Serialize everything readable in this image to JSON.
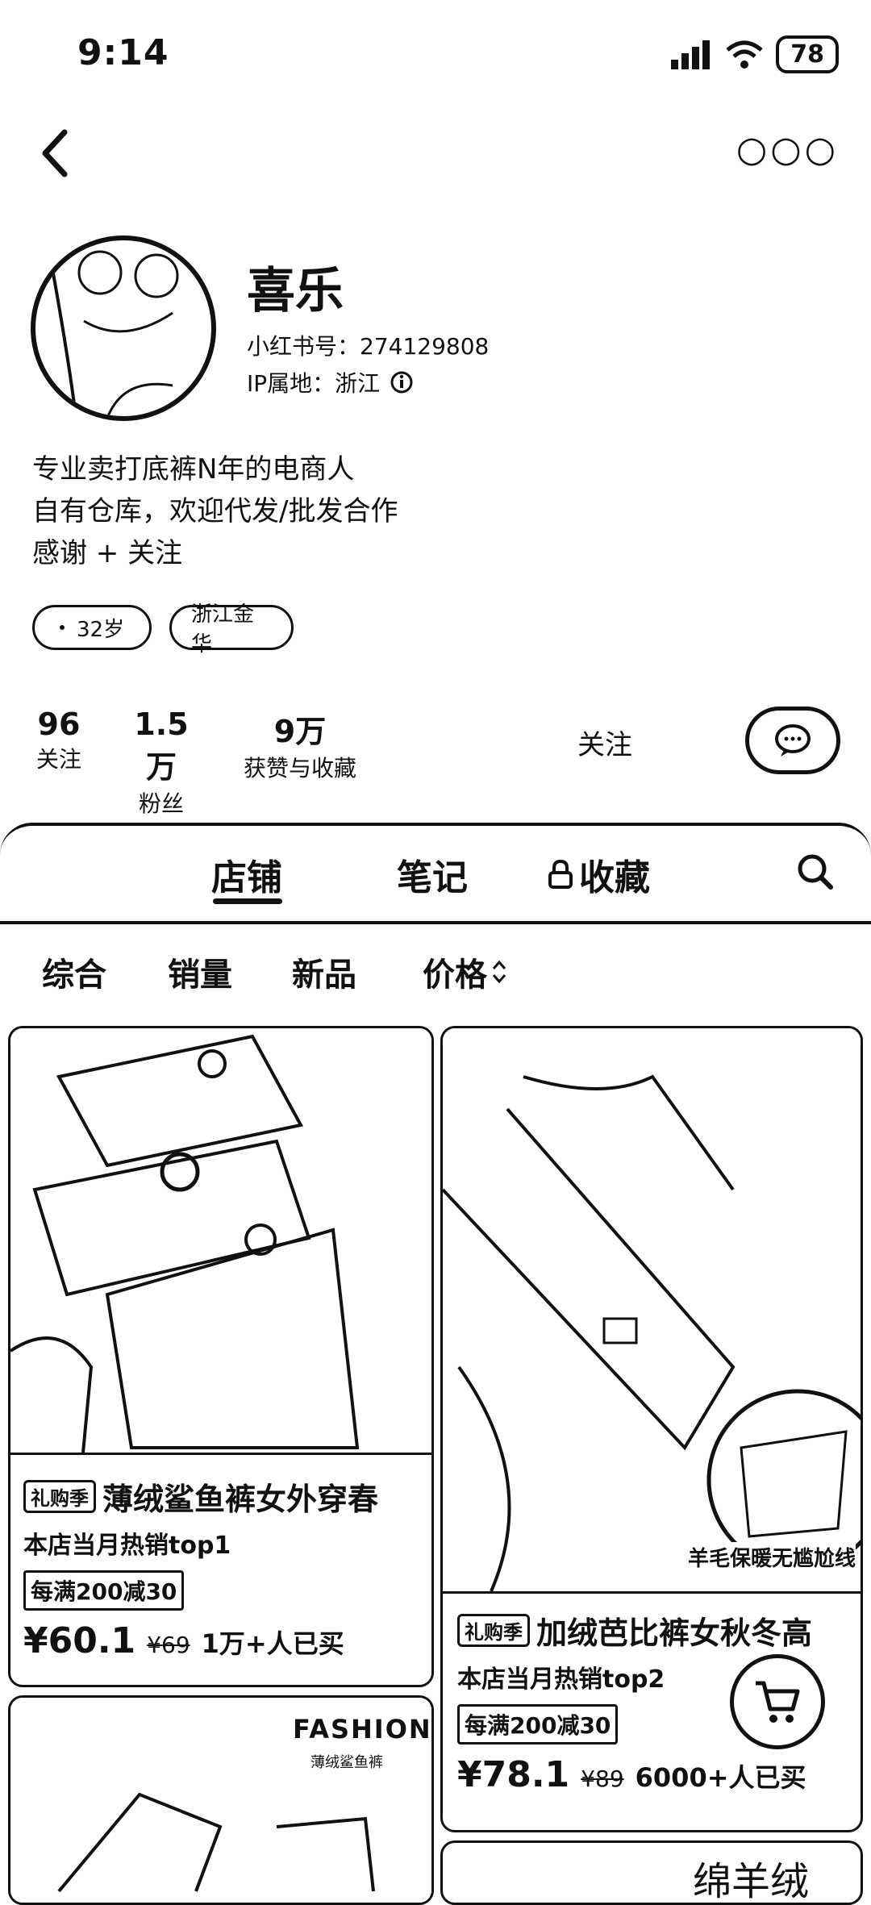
{
  "status": {
    "time": "9:14",
    "battery": "78"
  },
  "profile": {
    "name": "喜乐",
    "id_line": "小红书号：274129808",
    "ip_line": "IP属地：浙江",
    "bio": "专业卖打底裤N年的电商人\n自有仓库，欢迎代发/批发合作\n感谢 + 关注",
    "tags": [
      "32岁",
      "浙江金华"
    ]
  },
  "stats": [
    {
      "value": "96",
      "label": "关注"
    },
    {
      "value": "1.5万",
      "label": "粉丝"
    },
    {
      "value": "9万",
      "label": "获赞与收藏"
    }
  ],
  "actions": {
    "follow": "关注"
  },
  "tabs": [
    "店铺",
    "笔记",
    "收藏"
  ],
  "sort": [
    "综合",
    "销量",
    "新品",
    "价格"
  ],
  "products": [
    {
      "tag": "礼购季",
      "title": "薄绒鲨鱼裤女外穿春",
      "subtitle": "本店当月热销top1",
      "promo": "每满200减30",
      "price": "¥60.1",
      "orig": "¥69",
      "sold": "1万+人已买"
    },
    {
      "overlay": "羊毛保暖无尴尬线",
      "tag": "礼购季",
      "title": "加绒芭比裤女秋冬高",
      "subtitle": "本店当月热销top2",
      "promo": "每满200减30",
      "price": "¥78.1",
      "orig": "¥89",
      "sold": "6000+人已买"
    },
    {
      "brand": "FASHION",
      "brand_sub": "薄绒鲨鱼裤"
    },
    {
      "big_text": "绵羊绒"
    }
  ]
}
